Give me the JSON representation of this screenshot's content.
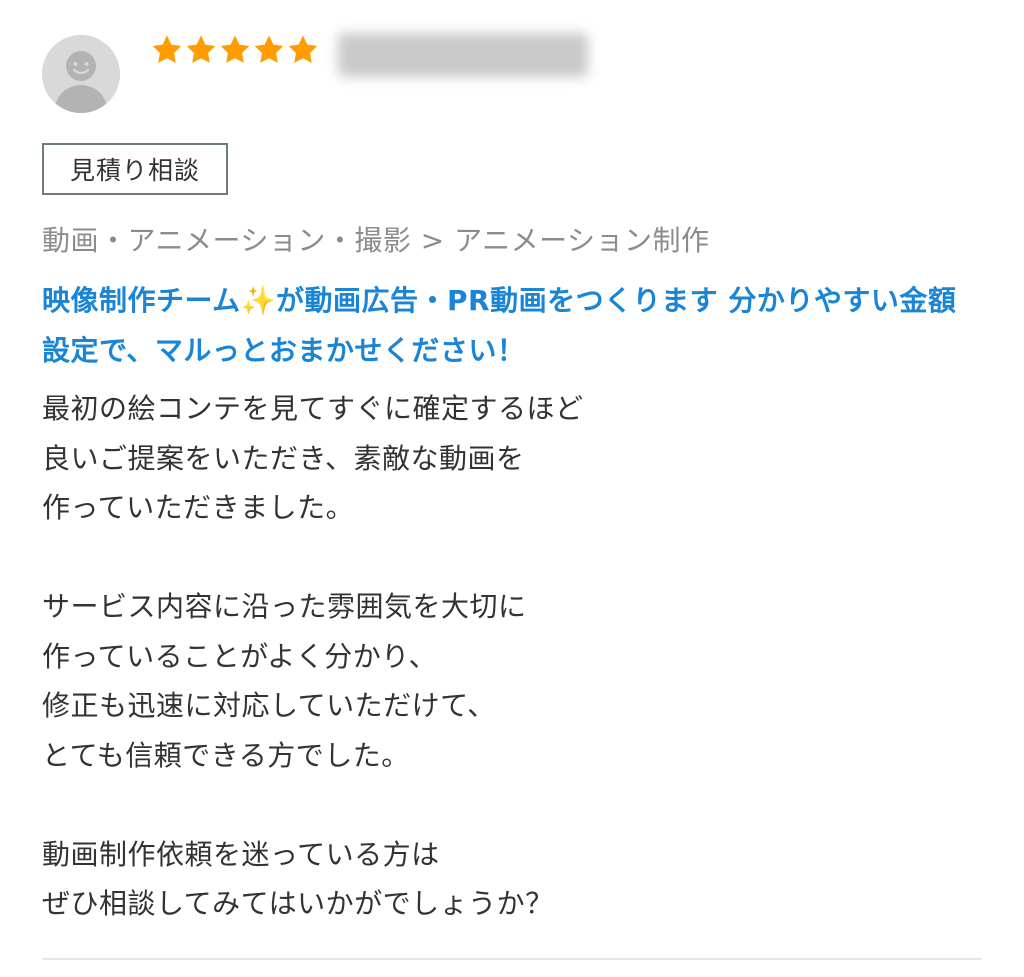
{
  "review": {
    "rating": 5,
    "rating_max": 5,
    "star_color": "#ff9d00",
    "avatar_icon": "user-avatar-icon",
    "tag_label": "見積り相談",
    "category": "動画・アニメーション・撮影 > アニメーション制作",
    "service_title": "映像制作チーム✨が動画広告・PR動画をつくります 分かりやすい金額設定で、マルっとおまかせください！",
    "service_title_color": "#1a85d6",
    "body": "最初の絵コンテを見てすぐに確定するほど\n良いご提案をいただき、素敵な動画を\n作っていただきました。\n\nサービス内容に沿った雰囲気を大切に\n作っていることがよく分かり、\n修正も迅速に対応していただけて、\nとても信頼できる方でした。\n\n動画制作依頼を迷っている方は\nぜひ相談してみてはいかがでしょうか？"
  }
}
